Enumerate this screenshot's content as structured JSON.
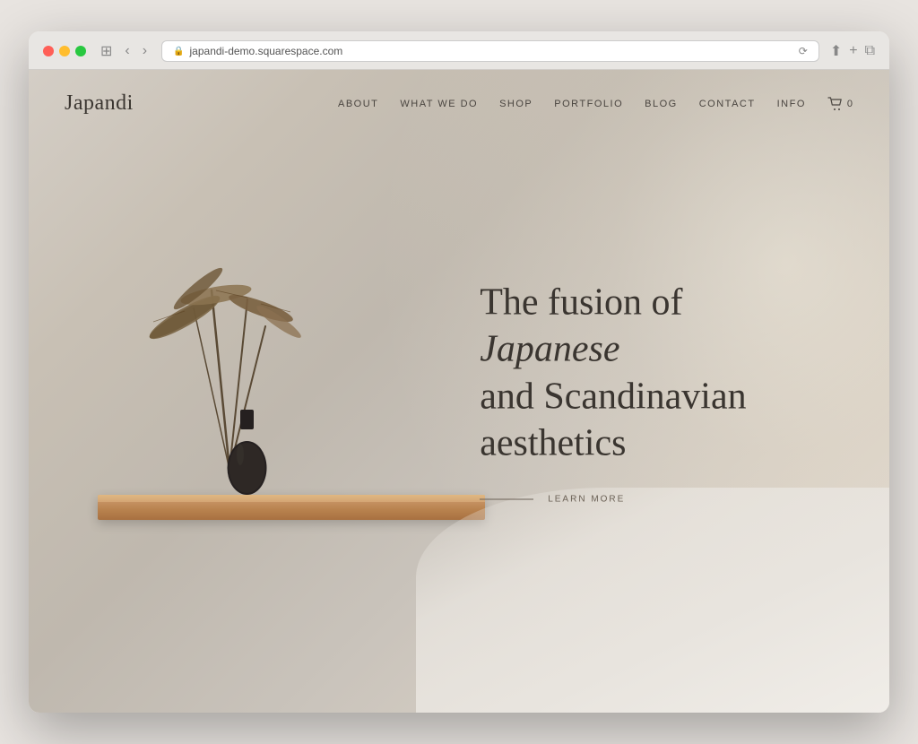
{
  "browser": {
    "url": "japandi-demo.squarespace.com",
    "reload_label": "⟳"
  },
  "site": {
    "logo": "Japandi",
    "nav": {
      "items": [
        {
          "label": "ABOUT",
          "id": "about"
        },
        {
          "label": "WHAT WE DO",
          "id": "what-we-do"
        },
        {
          "label": "SHOP",
          "id": "shop"
        },
        {
          "label": "PORTFOLIO",
          "id": "portfolio"
        },
        {
          "label": "BLOG",
          "id": "blog"
        },
        {
          "label": "CONTACT",
          "id": "contact"
        },
        {
          "label": "INFO",
          "id": "info"
        }
      ],
      "cart_count": "0"
    },
    "hero": {
      "heading_line1": "The fusion of ",
      "heading_italic": "Japanese",
      "heading_line2": "and Scandinavian",
      "heading_line3": "aesthetics",
      "cta_label": "LEARN MORE"
    }
  }
}
